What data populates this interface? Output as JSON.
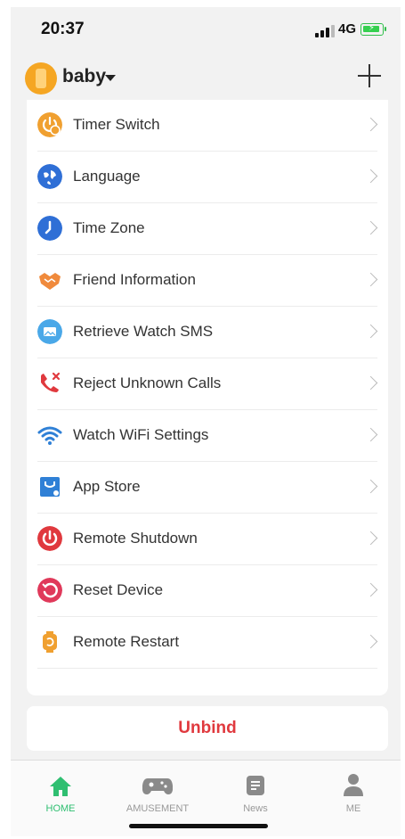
{
  "status_bar": {
    "time": "20:37",
    "network": "4G"
  },
  "header": {
    "device_name": "baby"
  },
  "settings": {
    "items": [
      {
        "label": "Timer Switch",
        "icon": "timer-switch-icon",
        "color": "#f0a030"
      },
      {
        "label": "Language",
        "icon": "globe-icon",
        "color": "#2f6fd6"
      },
      {
        "label": "Time Zone",
        "icon": "clock-icon",
        "color": "#2f6fd6"
      },
      {
        "label": "Friend Information",
        "icon": "handshake-icon",
        "color": "#f08a3c"
      },
      {
        "label": "Retrieve Watch SMS",
        "icon": "sms-icon",
        "color": "#4aa8e8"
      },
      {
        "label": "Reject Unknown Calls",
        "icon": "phone-reject-icon",
        "color": "#e0393e"
      },
      {
        "label": "Watch WiFi Settings",
        "icon": "wifi-icon",
        "color": "#2f80d6"
      },
      {
        "label": "App Store",
        "icon": "app-store-icon",
        "color": "#2f80d6"
      },
      {
        "label": "Remote Shutdown",
        "icon": "power-icon",
        "color": "#e0393e"
      },
      {
        "label": "Reset Device",
        "icon": "reset-icon",
        "color": "#e0395a"
      },
      {
        "label": "Remote Restart",
        "icon": "watch-restart-icon",
        "color": "#f0a030"
      }
    ]
  },
  "unbind": {
    "label": "Unbind",
    "color": "#e0393e"
  },
  "tabbar": {
    "tabs": [
      {
        "label": "HOME",
        "icon": "home-icon",
        "active": true
      },
      {
        "label": "AMUSEMENT",
        "icon": "gamepad-icon",
        "active": false
      },
      {
        "label": "News",
        "icon": "news-icon",
        "active": false
      },
      {
        "label": "ME",
        "icon": "person-icon",
        "active": false
      }
    ],
    "active_color": "#2fbf71"
  }
}
